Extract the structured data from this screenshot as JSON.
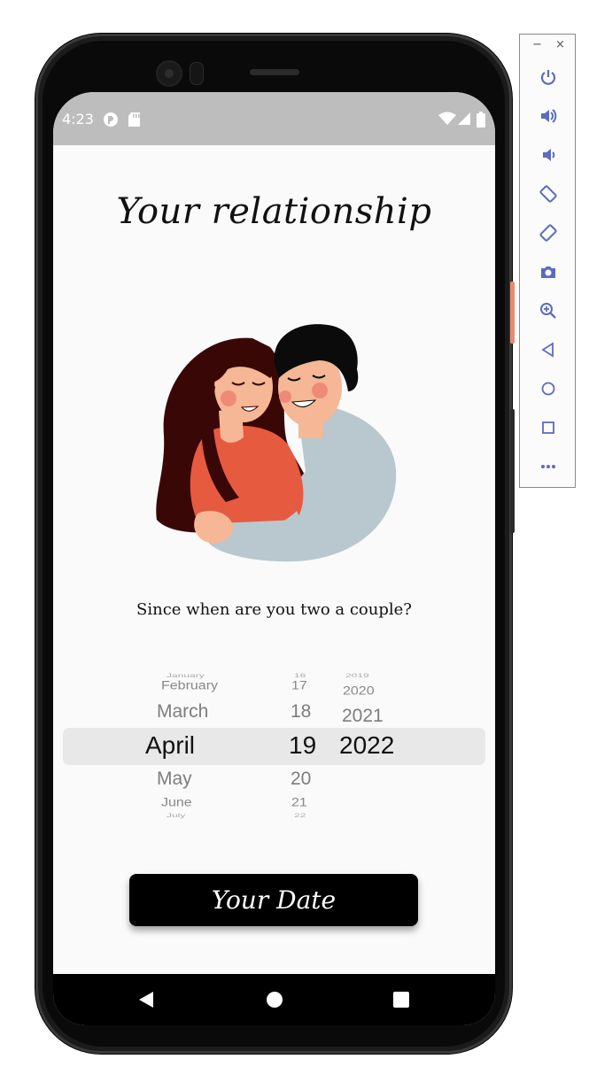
{
  "status_bar": {
    "time": "4:23",
    "icons": [
      "notification-app-icon",
      "sd-card-icon",
      "wifi-icon",
      "signal-icon",
      "battery-icon"
    ]
  },
  "app": {
    "title": "Your relationship",
    "illustration": "couple-hugging-illustration",
    "question": "Since when are you two a couple?",
    "action_button": "Your Date"
  },
  "date_picker": {
    "months": [
      "January",
      "February",
      "March",
      "April",
      "May",
      "June",
      "July"
    ],
    "days": [
      "16",
      "17",
      "18",
      "19",
      "20",
      "21",
      "22"
    ],
    "years": [
      "2019",
      "2020",
      "2021",
      "2022"
    ],
    "selected": {
      "month": "April",
      "day": "19",
      "year": "2022"
    }
  },
  "nav_bar": {
    "icons": [
      "back-icon",
      "home-icon",
      "recents-icon"
    ]
  },
  "emulator_toolbar": {
    "window_controls": [
      "−",
      "×"
    ],
    "buttons": [
      "power-icon",
      "volume-up-icon",
      "volume-down-icon",
      "rotate-left-icon",
      "rotate-right-icon",
      "screenshot-icon",
      "zoom-icon",
      "back-icon",
      "home-icon",
      "overview-icon",
      "more-icon"
    ]
  },
  "colors": {
    "status_bar_bg": "#bdbdbd",
    "screen_bg": "#fafafa",
    "button_bg": "#000000",
    "picker_highlight": "#e8e8e8",
    "woman_hair": "#3a0707",
    "woman_shirt": "#e65a40",
    "man_shirt": "#b9c7ce",
    "skin": "#f5b795"
  }
}
